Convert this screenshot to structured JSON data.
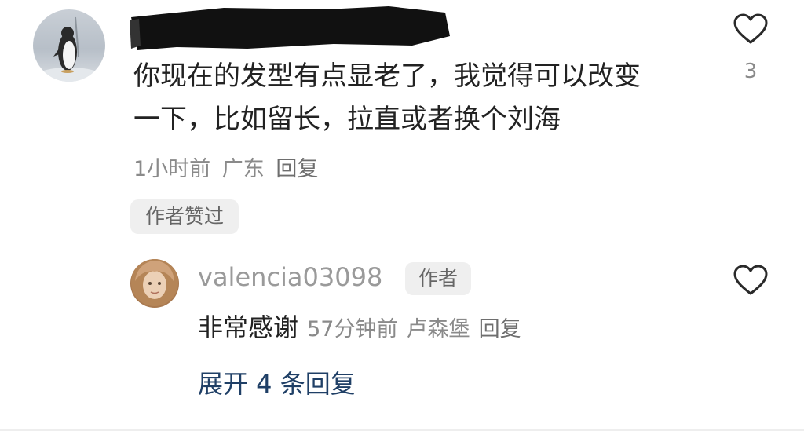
{
  "comment": {
    "text_line1": "你现在的发型有点显老了，我觉得可以改变",
    "text_line2": "一下，比如留长，拉直或者换个刘海",
    "time": "1小时前",
    "location": "广东",
    "reply_label": "回复",
    "liked_by_author_label": "作者赞过",
    "like_count": "3"
  },
  "reply": {
    "username": "valencia03098",
    "author_badge": "作者",
    "text": "非常感谢",
    "time": "57分钟前",
    "location": "卢森堡",
    "reply_label": "回复"
  },
  "expand_label": "展开 4 条回复",
  "icons": {
    "like": "heart-outline-icon"
  },
  "colors": {
    "link_blue": "#1f3f66",
    "meta_gray": "#8a8a8a"
  }
}
